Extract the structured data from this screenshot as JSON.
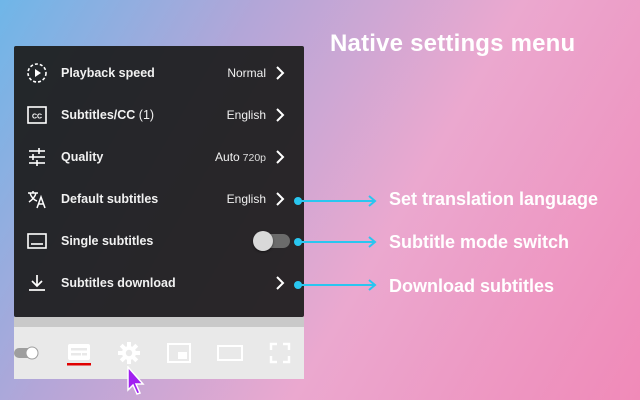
{
  "title": "Native settings menu",
  "menu": {
    "rows": [
      {
        "label": "Playback speed",
        "value": "Normal",
        "icon": "playback-speed-icon"
      },
      {
        "label": "Subtitles/CC",
        "count": " (1)",
        "value": "English",
        "icon": "closed-captions-icon"
      },
      {
        "label": "Quality",
        "value": "Auto",
        "value_sub": " 720p",
        "icon": "sliders-icon"
      },
      {
        "label": "Default subtitles",
        "value": "English",
        "icon": "translate-icon"
      },
      {
        "label": "Single subtitles",
        "toggle": false,
        "icon": "subtitle-box-icon"
      },
      {
        "label": "Subtitles download",
        "icon": "download-icon"
      }
    ]
  },
  "callouts": [
    {
      "text": "Set translation language"
    },
    {
      "text": "Subtitle mode switch"
    },
    {
      "text": "Download subtitles"
    }
  ],
  "player_controls": [
    "autoplay-toggle-icon",
    "subtitles-icon",
    "settings-gear-icon",
    "miniplayer-icon",
    "theater-mode-icon",
    "fullscreen-icon"
  ],
  "colors": {
    "menu_bg": "#1c1c1c",
    "text": "#f1f1f1",
    "callout_arrow": "#29c6f0",
    "subtitles_active_underline": "#e00000",
    "cursor": "#a020f0"
  }
}
